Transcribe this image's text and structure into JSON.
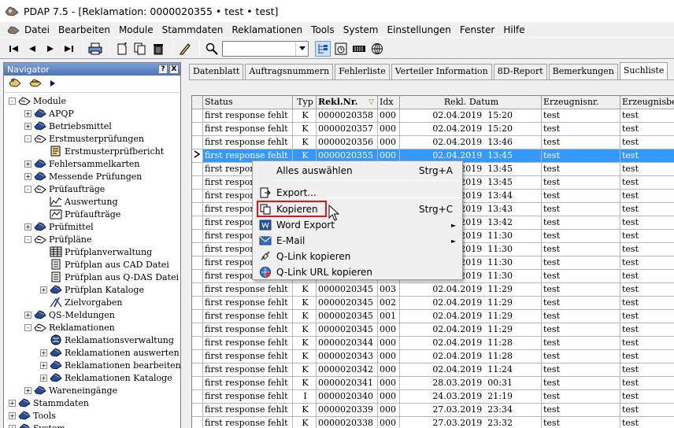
{
  "window": {
    "title": "PDAP 7.5 - [Reklamation:  0000020355 • test • test]"
  },
  "menu": [
    "Datei",
    "Bearbeiten",
    "Module",
    "Stammdaten",
    "Reklamationen",
    "Tools",
    "System",
    "Einstellungen",
    "Fenster",
    "Hilfe"
  ],
  "navigator": {
    "title": "Navigator",
    "help": "?",
    "close": "X",
    "tree": [
      {
        "label": "Module",
        "level": 0,
        "expander": "-",
        "icon": "folder-open-icon"
      },
      {
        "label": "APQP",
        "level": 1,
        "expander": "+",
        "icon": "module-icon"
      },
      {
        "label": "Betriebsmittel",
        "level": 1,
        "expander": "+",
        "icon": "module-icon"
      },
      {
        "label": "Erstmusterprüfungen",
        "level": 1,
        "expander": "-",
        "icon": "folder-open-icon"
      },
      {
        "label": "Erstmusterprüfbericht",
        "level": 2,
        "expander": "",
        "icon": "report-icon"
      },
      {
        "label": "Fehlersammelkarten",
        "level": 1,
        "expander": "+",
        "icon": "module-icon"
      },
      {
        "label": "Messende Prüfungen",
        "level": 1,
        "expander": "+",
        "icon": "module-icon"
      },
      {
        "label": "Prüfaufträge",
        "level": 1,
        "expander": "-",
        "icon": "folder-open-icon"
      },
      {
        "label": "Auswertung",
        "level": 2,
        "expander": "",
        "icon": "chart-icon"
      },
      {
        "label": "Prüfaufträge",
        "level": 2,
        "expander": "",
        "icon": "order-icon"
      },
      {
        "label": "Prüfmittel",
        "level": 1,
        "expander": "+",
        "icon": "module-icon"
      },
      {
        "label": "Prüfpläne",
        "level": 1,
        "expander": "-",
        "icon": "folder-open-icon"
      },
      {
        "label": "Prüfplanverwaltung",
        "level": 2,
        "expander": "",
        "icon": "table-icon"
      },
      {
        "label": "Prüfplan aus CAD Datei",
        "level": 2,
        "expander": "",
        "icon": "document-icon"
      },
      {
        "label": "Prüfplan aus Q-DAS Datei",
        "level": 2,
        "expander": "",
        "icon": "document-icon"
      },
      {
        "label": "Prüfplan Kataloge",
        "level": 2,
        "expander": "+",
        "icon": "module-icon"
      },
      {
        "label": "Zielvorgaben",
        "level": 2,
        "expander": "",
        "icon": "target-icon"
      },
      {
        "label": "QS-Meldungen",
        "level": 1,
        "expander": "+",
        "icon": "module-icon"
      },
      {
        "label": "Reklamationen",
        "level": 1,
        "expander": "-",
        "icon": "folder-open-icon"
      },
      {
        "label": "Reklamationsverwaltung",
        "level": 2,
        "expander": "",
        "icon": "globe-icon"
      },
      {
        "label": "Reklamationen auswerten",
        "level": 2,
        "expander": "+",
        "icon": "module-icon"
      },
      {
        "label": "Reklamationen bearbeiten",
        "level": 2,
        "expander": "+",
        "icon": "module-icon"
      },
      {
        "label": "Reklamationen Kataloge",
        "level": 2,
        "expander": "+",
        "icon": "module-icon"
      },
      {
        "label": "Wareneingänge",
        "level": 1,
        "expander": "+",
        "icon": "module-icon"
      },
      {
        "label": "Stammdaten",
        "level": 0,
        "expander": "+",
        "icon": "module-icon"
      },
      {
        "label": "Tools",
        "level": 0,
        "expander": "+",
        "icon": "module-icon"
      },
      {
        "label": "System",
        "level": 0,
        "expander": "+",
        "icon": "module-icon"
      }
    ]
  },
  "tabs": [
    "Datenblatt",
    "Auftragsnummern",
    "Fehlerliste",
    "Verteiler Information",
    "8D-Report",
    "Bemerkungen",
    "Suchliste"
  ],
  "active_tab": "Suchliste",
  "table": {
    "columns": [
      "Status",
      "Typ",
      "Rekl.Nr.",
      "Idx",
      "Rekl. Datum",
      "Erzeugnisnr.",
      "Erzeugnisbez."
    ],
    "sort_indicator": "▽",
    "rows": [
      [
        "first response fehlt",
        "K",
        "0000020358",
        "000",
        "02.04.2019  15:20",
        "test",
        "test"
      ],
      [
        "first response fehlt",
        "K",
        "0000020357",
        "000",
        "02.04.2019  15:20",
        "test",
        "test"
      ],
      [
        "first response fehlt",
        "K",
        "0000020356",
        "000",
        "02.04.2019  13:46",
        "test",
        "test"
      ],
      [
        "first response fehlt",
        "K",
        "0000020355",
        "000",
        "02.04.2019  13:45",
        "test",
        "test"
      ],
      [
        "first response fehlt",
        "",
        "",
        "",
        "02.04.2019  13:45",
        "test",
        "test"
      ],
      [
        "first response fehlt",
        "",
        "",
        "",
        "02.04.2019  13:45",
        "test",
        "test"
      ],
      [
        "first response fehlt",
        "",
        "",
        "",
        "02.04.2019  13:44",
        "test",
        "test"
      ],
      [
        "first response fehlt",
        "",
        "",
        "",
        "02.04.2019  13:43",
        "test",
        "test"
      ],
      [
        "first response fehlt",
        "",
        "",
        "",
        "02.04.2019  13:42",
        "test",
        "test"
      ],
      [
        "first response fehlt",
        "",
        "",
        "",
        "02.04.2019  11:30",
        "test",
        "test"
      ],
      [
        "first response fehlt",
        "",
        "",
        "",
        "02.04.2019  11:30",
        "test",
        "test"
      ],
      [
        "first response fehlt",
        "",
        "",
        "",
        "02.04.2019  11:30",
        "test",
        "test"
      ],
      [
        "first response fehlt",
        "",
        "",
        "",
        "02.04.2019  11:30",
        "test",
        "test"
      ],
      [
        "first response fehlt",
        "K",
        "0000020345",
        "003",
        "02.04.2019  11:29",
        "test",
        "test"
      ],
      [
        "first response fehlt",
        "K",
        "0000020345",
        "002",
        "02.04.2019  11:29",
        "test",
        "test"
      ],
      [
        "first response fehlt",
        "K",
        "0000020345",
        "001",
        "02.04.2019  11:29",
        "test",
        "test"
      ],
      [
        "first response fehlt",
        "K",
        "0000020345",
        "000",
        "02.04.2019  11:29",
        "test",
        "test"
      ],
      [
        "first response fehlt",
        "K",
        "0000020344",
        "000",
        "02.04.2019  11:28",
        "test",
        "test"
      ],
      [
        "first response fehlt",
        "K",
        "0000020343",
        "000",
        "02.04.2019  11:28",
        "test",
        "test"
      ],
      [
        "first response fehlt",
        "K",
        "0000020342",
        "000",
        "02.04.2019  11:24",
        "test",
        "test"
      ],
      [
        "first response fehlt",
        "K",
        "0000020341",
        "000",
        "28.03.2019  00:31",
        "test",
        "test"
      ],
      [
        "first response fehlt",
        "I",
        "0000020340",
        "000",
        "24.03.2019  21:19",
        "test",
        "test"
      ],
      [
        "first response fehlt",
        "K",
        "0000020339",
        "000",
        "27.03.2019  23:34",
        "test",
        "test"
      ],
      [
        "first response fehlt",
        "K",
        "0000020338",
        "000",
        "27.03.2019  23:32",
        "test",
        "test"
      ]
    ],
    "selected_row": 3
  },
  "context_menu": {
    "items": [
      {
        "label": "Alles auswählen",
        "shortcut": "Strg+A",
        "icon": ""
      },
      {
        "label": "Export...",
        "shortcut": "",
        "icon": "export-icon"
      },
      {
        "label": "Kopieren",
        "shortcut": "Strg+C",
        "icon": "copy-icon"
      },
      {
        "label": "Word Export",
        "shortcut": "",
        "icon": "word-icon",
        "submenu": "►"
      },
      {
        "label": "E-Mail",
        "shortcut": "",
        "icon": "email-icon",
        "submenu": "►"
      },
      {
        "label": "Q-Link kopieren",
        "shortcut": "",
        "icon": "link-icon"
      },
      {
        "label": "Q-Link URL kopieren",
        "shortcut": "",
        "icon": "url-link-icon"
      }
    ]
  },
  "colors": {
    "selection": "#3399ff",
    "highlight_box": "#e0141e",
    "nav_header": "#4b73b8"
  }
}
